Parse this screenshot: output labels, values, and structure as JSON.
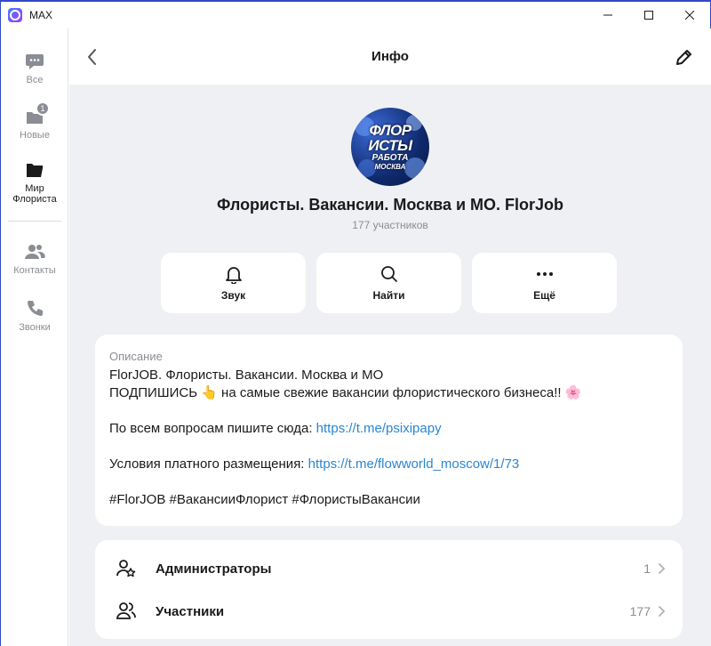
{
  "window": {
    "title": "MAX"
  },
  "rail": {
    "items": [
      {
        "label": "Все",
        "icon": "chat-bubble-icon"
      },
      {
        "label": "Новые",
        "icon": "new-folder-icon",
        "badge": "1"
      },
      {
        "label": "Мир\nФлориста",
        "icon": "folder-icon",
        "active": true
      },
      {
        "label": "Контакты",
        "icon": "contacts-icon"
      },
      {
        "label": "Звонки",
        "icon": "phone-icon"
      }
    ]
  },
  "header": {
    "title": "Инфо"
  },
  "group": {
    "avatar_line1": "ФЛОР",
    "avatar_line2": "ИСТЫ",
    "avatar_line3": "РАБОТА",
    "avatar_line4": "МОСКВА",
    "name": "Флористы. Вакансии. Москва и МО. FlorJob",
    "members": "177 участников"
  },
  "actions": [
    {
      "label": "Звук",
      "icon": "bell-icon"
    },
    {
      "label": "Найти",
      "icon": "search-icon"
    },
    {
      "label": "Ещё",
      "icon": "more-dots-icon"
    }
  ],
  "description": {
    "title": "Описание",
    "line1": "FlorJOB. Флористы. Вакансии. Москва и МО",
    "line2": "ПОДПИШИСЬ 👆  на самые свежие вакансии флористического бизнеса!! 🌸",
    "line3_prefix": "По всем вопросам пишите сюда: ",
    "line3_link": "https://t.me/psixipapy",
    "line4_prefix": "Условия платного размещения: ",
    "line4_link": "https://t.me/flowworld_moscow/1/73",
    "line5": "#FlorJOB #ВакансииФлорист #ФлористыВакансии"
  },
  "list": {
    "admins_label": "Администраторы",
    "admins_count": "1",
    "members_label": "Участники",
    "members_count": "177"
  },
  "colors": {
    "accent": "#2f49c7",
    "link": "#2a86d4",
    "background": "#eff0f3"
  }
}
